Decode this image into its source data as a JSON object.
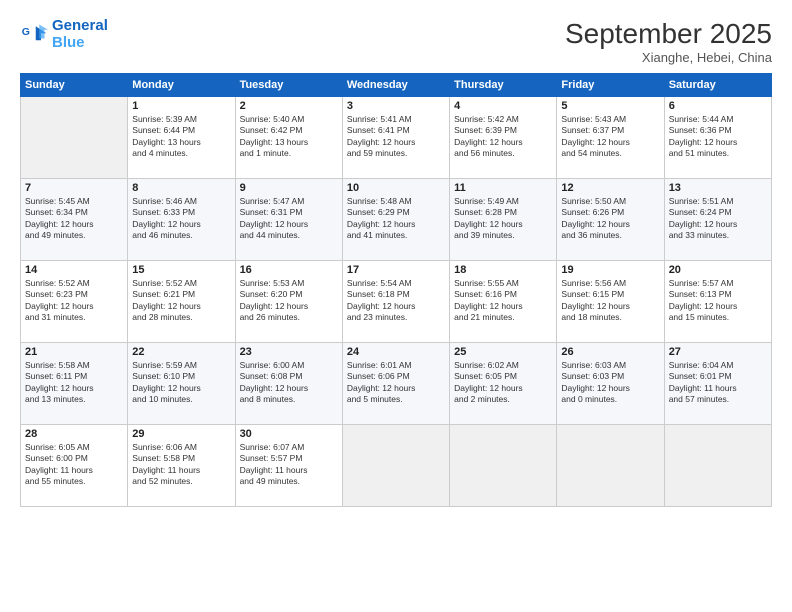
{
  "logo": {
    "line1": "General",
    "line2": "Blue"
  },
  "title": "September 2025",
  "subtitle": "Xianghe, Hebei, China",
  "days_header": [
    "Sunday",
    "Monday",
    "Tuesday",
    "Wednesday",
    "Thursday",
    "Friday",
    "Saturday"
  ],
  "weeks": [
    [
      {
        "num": "",
        "info": ""
      },
      {
        "num": "1",
        "info": "Sunrise: 5:39 AM\nSunset: 6:44 PM\nDaylight: 13 hours\nand 4 minutes."
      },
      {
        "num": "2",
        "info": "Sunrise: 5:40 AM\nSunset: 6:42 PM\nDaylight: 13 hours\nand 1 minute."
      },
      {
        "num": "3",
        "info": "Sunrise: 5:41 AM\nSunset: 6:41 PM\nDaylight: 12 hours\nand 59 minutes."
      },
      {
        "num": "4",
        "info": "Sunrise: 5:42 AM\nSunset: 6:39 PM\nDaylight: 12 hours\nand 56 minutes."
      },
      {
        "num": "5",
        "info": "Sunrise: 5:43 AM\nSunset: 6:37 PM\nDaylight: 12 hours\nand 54 minutes."
      },
      {
        "num": "6",
        "info": "Sunrise: 5:44 AM\nSunset: 6:36 PM\nDaylight: 12 hours\nand 51 minutes."
      }
    ],
    [
      {
        "num": "7",
        "info": "Sunrise: 5:45 AM\nSunset: 6:34 PM\nDaylight: 12 hours\nand 49 minutes."
      },
      {
        "num": "8",
        "info": "Sunrise: 5:46 AM\nSunset: 6:33 PM\nDaylight: 12 hours\nand 46 minutes."
      },
      {
        "num": "9",
        "info": "Sunrise: 5:47 AM\nSunset: 6:31 PM\nDaylight: 12 hours\nand 44 minutes."
      },
      {
        "num": "10",
        "info": "Sunrise: 5:48 AM\nSunset: 6:29 PM\nDaylight: 12 hours\nand 41 minutes."
      },
      {
        "num": "11",
        "info": "Sunrise: 5:49 AM\nSunset: 6:28 PM\nDaylight: 12 hours\nand 39 minutes."
      },
      {
        "num": "12",
        "info": "Sunrise: 5:50 AM\nSunset: 6:26 PM\nDaylight: 12 hours\nand 36 minutes."
      },
      {
        "num": "13",
        "info": "Sunrise: 5:51 AM\nSunset: 6:24 PM\nDaylight: 12 hours\nand 33 minutes."
      }
    ],
    [
      {
        "num": "14",
        "info": "Sunrise: 5:52 AM\nSunset: 6:23 PM\nDaylight: 12 hours\nand 31 minutes."
      },
      {
        "num": "15",
        "info": "Sunrise: 5:52 AM\nSunset: 6:21 PM\nDaylight: 12 hours\nand 28 minutes."
      },
      {
        "num": "16",
        "info": "Sunrise: 5:53 AM\nSunset: 6:20 PM\nDaylight: 12 hours\nand 26 minutes."
      },
      {
        "num": "17",
        "info": "Sunrise: 5:54 AM\nSunset: 6:18 PM\nDaylight: 12 hours\nand 23 minutes."
      },
      {
        "num": "18",
        "info": "Sunrise: 5:55 AM\nSunset: 6:16 PM\nDaylight: 12 hours\nand 21 minutes."
      },
      {
        "num": "19",
        "info": "Sunrise: 5:56 AM\nSunset: 6:15 PM\nDaylight: 12 hours\nand 18 minutes."
      },
      {
        "num": "20",
        "info": "Sunrise: 5:57 AM\nSunset: 6:13 PM\nDaylight: 12 hours\nand 15 minutes."
      }
    ],
    [
      {
        "num": "21",
        "info": "Sunrise: 5:58 AM\nSunset: 6:11 PM\nDaylight: 12 hours\nand 13 minutes."
      },
      {
        "num": "22",
        "info": "Sunrise: 5:59 AM\nSunset: 6:10 PM\nDaylight: 12 hours\nand 10 minutes."
      },
      {
        "num": "23",
        "info": "Sunrise: 6:00 AM\nSunset: 6:08 PM\nDaylight: 12 hours\nand 8 minutes."
      },
      {
        "num": "24",
        "info": "Sunrise: 6:01 AM\nSunset: 6:06 PM\nDaylight: 12 hours\nand 5 minutes."
      },
      {
        "num": "25",
        "info": "Sunrise: 6:02 AM\nSunset: 6:05 PM\nDaylight: 12 hours\nand 2 minutes."
      },
      {
        "num": "26",
        "info": "Sunrise: 6:03 AM\nSunset: 6:03 PM\nDaylight: 12 hours\nand 0 minutes."
      },
      {
        "num": "27",
        "info": "Sunrise: 6:04 AM\nSunset: 6:01 PM\nDaylight: 11 hours\nand 57 minutes."
      }
    ],
    [
      {
        "num": "28",
        "info": "Sunrise: 6:05 AM\nSunset: 6:00 PM\nDaylight: 11 hours\nand 55 minutes."
      },
      {
        "num": "29",
        "info": "Sunrise: 6:06 AM\nSunset: 5:58 PM\nDaylight: 11 hours\nand 52 minutes."
      },
      {
        "num": "30",
        "info": "Sunrise: 6:07 AM\nSunset: 5:57 PM\nDaylight: 11 hours\nand 49 minutes."
      },
      {
        "num": "",
        "info": ""
      },
      {
        "num": "",
        "info": ""
      },
      {
        "num": "",
        "info": ""
      },
      {
        "num": "",
        "info": ""
      }
    ]
  ]
}
